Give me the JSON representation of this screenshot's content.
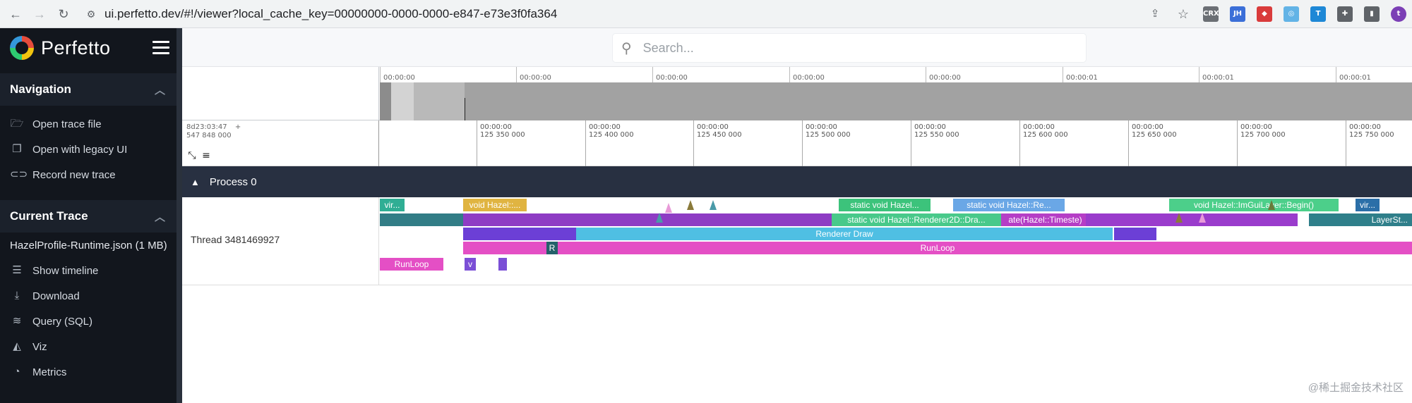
{
  "browser": {
    "url": "ui.perfetto.dev/#!/viewer?local_cache_key=00000000-0000-0000-e847-e73e3f0fa364",
    "extensions": [
      {
        "name": "crx-icon",
        "label": "CRX",
        "color": "#6b6f74"
      },
      {
        "name": "jh-icon",
        "label": "JH",
        "color": "#3b6fd8"
      },
      {
        "name": "shield-ext-icon",
        "label": "◆",
        "color": "#d93b3b"
      },
      {
        "name": "circle-ext-icon",
        "label": "◎",
        "color": "#62b3e6"
      },
      {
        "name": "translate-ext-icon",
        "label": "T",
        "color": "#1e88d6"
      },
      {
        "name": "puzzle-icon",
        "label": "✚",
        "color": "#5f6368"
      },
      {
        "name": "sidepanel-icon",
        "label": "▮",
        "color": "#5f6368"
      },
      {
        "name": "profile-avatar",
        "label": "t",
        "color": "#7b3fb5"
      }
    ]
  },
  "sidebar": {
    "brand": "Perfetto",
    "navigation": {
      "title": "Navigation",
      "items": [
        {
          "label": "Open trace file",
          "icon": "folder-open-icon"
        },
        {
          "label": "Open with legacy UI",
          "icon": "legacy-window-icon"
        },
        {
          "label": "Record new trace",
          "icon": "record-toggle-icon"
        }
      ]
    },
    "current_trace": {
      "title": "Current Trace",
      "file": "HazelProfile-Runtime.json (1 MB)",
      "items": [
        {
          "label": "Show timeline",
          "icon": "timeline-icon"
        },
        {
          "label": "Download",
          "icon": "download-icon"
        },
        {
          "label": "Query (SQL)",
          "icon": "database-icon"
        },
        {
          "label": "Viz",
          "icon": "chart-icon"
        },
        {
          "label": "Metrics",
          "icon": "gauge-icon"
        }
      ]
    }
  },
  "search": {
    "placeholder": "Search..."
  },
  "overview": {
    "ticks": [
      "00:00:00",
      "00:00:00",
      "00:00:00",
      "00:00:00",
      "00:00:00",
      "00:00:01",
      "00:00:01",
      "00:00:01"
    ]
  },
  "ruler": {
    "offset_line1": "8d23:03:47",
    "offset_plus": "+",
    "offset_line2": "547 848 000",
    "ticks": [
      {
        "top": "00:00:00",
        "bottom": "125 350 000"
      },
      {
        "top": "00:00:00",
        "bottom": "125 400 000"
      },
      {
        "top": "00:00:00",
        "bottom": "125 450 000"
      },
      {
        "top": "00:00:00",
        "bottom": "125 500 000"
      },
      {
        "top": "00:00:00",
        "bottom": "125 550 000"
      },
      {
        "top": "00:00:00",
        "bottom": "125 600 000"
      },
      {
        "top": "00:00:00",
        "bottom": "125 650 000"
      },
      {
        "top": "00:00:00",
        "bottom": "125 700 000"
      },
      {
        "top": "00:00:00",
        "bottom": "125 750 000"
      }
    ]
  },
  "process": {
    "title": "Process 0"
  },
  "thread": {
    "label": "Thread 3481469927",
    "slices": [
      {
        "text": "vir...",
        "color": "#2fae94"
      },
      {
        "text": "void Hazel::...",
        "color": "#e0b441"
      },
      {
        "text": "static void Hazel...",
        "color": "#3cc37b"
      },
      {
        "text": "static void Hazel::Re...",
        "color": "#6aa7e6"
      },
      {
        "text": "void Hazel::ImGuiLayer::Begin()",
        "color": "#4ccf8a"
      },
      {
        "text": "vir...",
        "color": "#2b6fa8"
      },
      {
        "text": "",
        "color": "#327d86"
      },
      {
        "text": "",
        "color": "#8e3cc4"
      },
      {
        "text": "static void Hazel::Renderer2D::Dra...",
        "color": "#48c98a"
      },
      {
        "text": "ate(Hazel::Timeste)",
        "color": "#b53ec6"
      },
      {
        "text": "",
        "color": "#9a3ccc"
      },
      {
        "text": "",
        "color": "#327d86"
      },
      {
        "text": "LayerSt...",
        "color": "#2f7f8a"
      },
      {
        "text": "",
        "color": "#6c3fd6"
      },
      {
        "text": "Renderer Draw",
        "color": "#4fbfe3"
      },
      {
        "text": "",
        "color": "#6c3fd6"
      },
      {
        "text": "RunLoop",
        "color": "#e44fc5"
      },
      {
        "text": "R",
        "color": "#24616a"
      },
      {
        "text": "RunLoop",
        "color": "#e44fc5"
      },
      {
        "text": "v",
        "color": "#7b4fd6"
      },
      {
        "text": "",
        "color": "#7b4fd6"
      }
    ],
    "flows": [
      {
        "color": "#e89ad8"
      },
      {
        "color": "#8a7a3a"
      },
      {
        "color": "#4a9aa8"
      },
      {
        "color": "#4a9aa8"
      },
      {
        "color": "#8a7a3a"
      },
      {
        "color": "#e89ad8"
      },
      {
        "color": "#6a7a3a"
      }
    ]
  },
  "watermark": "@稀土掘金技术社区"
}
